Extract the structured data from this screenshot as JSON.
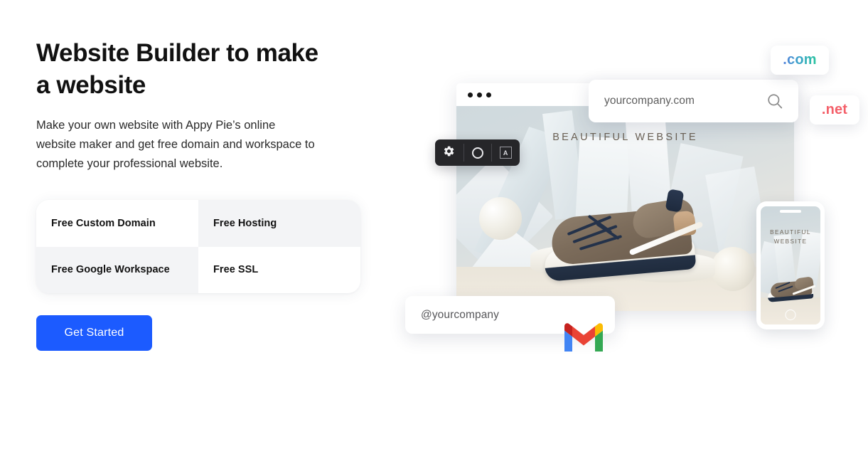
{
  "hero": {
    "title": "Website Builder to make a website",
    "description": "Make your own website with Appy Pie’s online website maker and get free domain and workspace to complete your professional website.",
    "cta_label": "Get Started"
  },
  "features": [
    {
      "label": "Free Custom Domain"
    },
    {
      "label": "Free Hosting"
    },
    {
      "label": "Free Google Workspace"
    },
    {
      "label": "Free SSL"
    }
  ],
  "artwork": {
    "browser": {
      "dots_count": 3,
      "canvas_title": "BEAUTIFUL WEBSITE"
    },
    "search_bar": {
      "value": "yourcompany.com",
      "icon": "search-icon"
    },
    "email_bar": {
      "value": "@yourcompany",
      "logo": "gmail-logo"
    },
    "badges": {
      "com": ".com",
      "net": ".net"
    },
    "toolbar": {
      "items": [
        {
          "icon": "gear-icon"
        },
        {
          "icon": "circle-icon"
        },
        {
          "icon": "text-box-icon",
          "glyph": "A"
        }
      ]
    },
    "phone": {
      "title": "BEAUTIFUL WEBSITE"
    }
  },
  "colors": {
    "accent_blue": "#1c5bff",
    "badge_net": "#f4606a",
    "feature_shade": "#f3f4f6",
    "toolbar_bg": "#262629"
  }
}
